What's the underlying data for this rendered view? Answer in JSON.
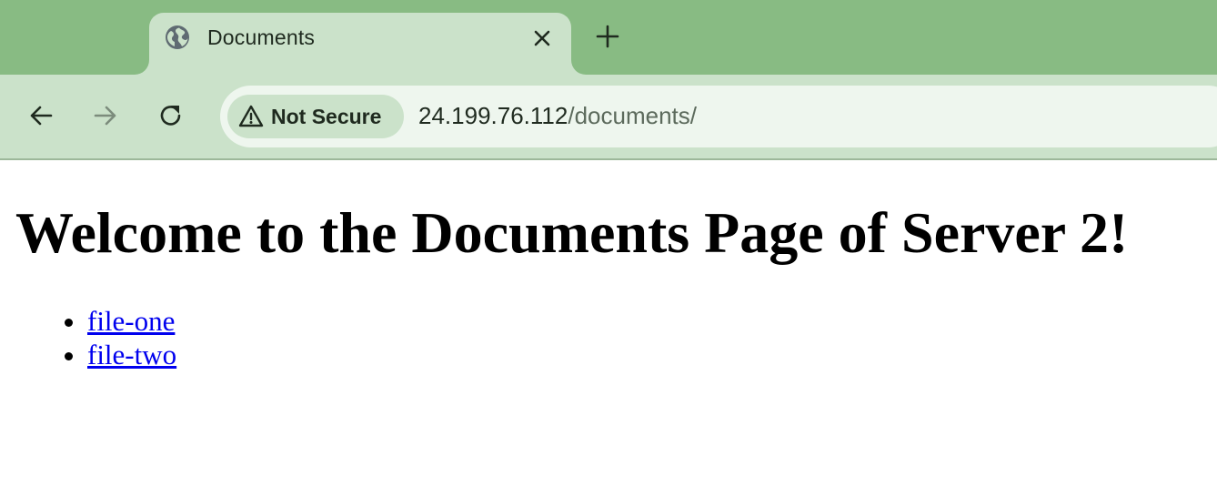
{
  "browser": {
    "tab": {
      "title": "Documents",
      "favicon": "globe-icon",
      "close_icon": "close-icon"
    },
    "new_tab_icon": "plus-icon",
    "toolbar": {
      "back_icon": "back-arrow-icon",
      "forward_icon": "forward-arrow-icon",
      "reload_icon": "reload-icon"
    },
    "omnibox": {
      "security_icon": "warning-icon",
      "security_label": "Not Secure",
      "url_host": "24.199.76.112",
      "url_path": "/documents/"
    },
    "colors": {
      "tabstrip": "#88bb83",
      "active_tab": "#cbe2ca",
      "omnibox": "#eef6ee",
      "link": "#0000ee"
    }
  },
  "page": {
    "heading": "Welcome to the Documents Page of Server 2!",
    "links": [
      {
        "label": "file-one"
      },
      {
        "label": "file-two"
      }
    ]
  }
}
